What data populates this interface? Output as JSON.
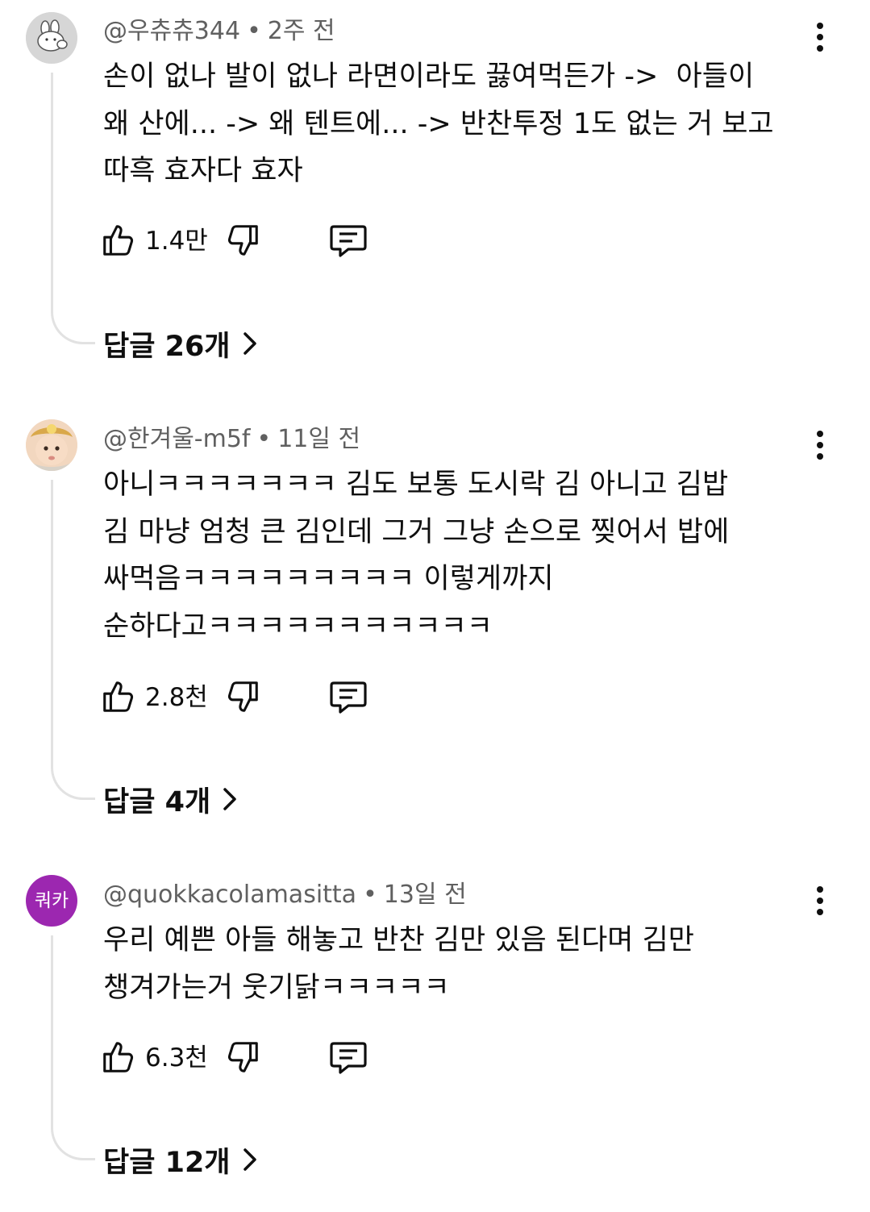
{
  "comments": [
    {
      "author": "@우츄츄344",
      "time": "2주 전",
      "text": "손이 없나 발이 없나 라면이라도 끓여먹든가 ->  아들이\n왜 산에... -> 왜 텐트에... -> 반찬투정 1도 없는 거 보고\n따흑 효자다 효자",
      "likes": "1.4만",
      "replies_label": "답글 26개",
      "avatar_icon": "bunny-doodle-avatar"
    },
    {
      "author": "@한겨울-m5f",
      "time": "11일 전",
      "text": "아니ㅋㅋㅋㅋㅋㅋㅋ 김도 보통 도시락 김 아니고 김밥\n김 마냥 엄청 큰 김인데 그거 그냥 손으로 찢어서 밥에\n싸먹음ㅋㅋㅋㅋㅋㅋㅋㅋㅋ 이렇게까지\n순하다고ㅋㅋㅋㅋㅋㅋㅋㅋㅋㅋㅋ",
      "likes": "2.8천",
      "replies_label": "답글 4개",
      "avatar_icon": "baby-photo-avatar"
    },
    {
      "author": "@quokkacolamasitta",
      "time": "13일 전",
      "text": "우리 예쁜 아들 해놓고 반찬 김만 있음 된다며 김만\n챙겨가는거 웃기닭ㅋㅋㅋㅋㅋ",
      "likes": "6.3천",
      "replies_label": "답글 12개",
      "avatar_text": "쿼카",
      "avatar_color": "#9c27b0"
    }
  ],
  "separator": "•",
  "colors": {
    "text": "#0f0f0f",
    "meta": "#606060",
    "thread_line": "#e2e2e2"
  }
}
